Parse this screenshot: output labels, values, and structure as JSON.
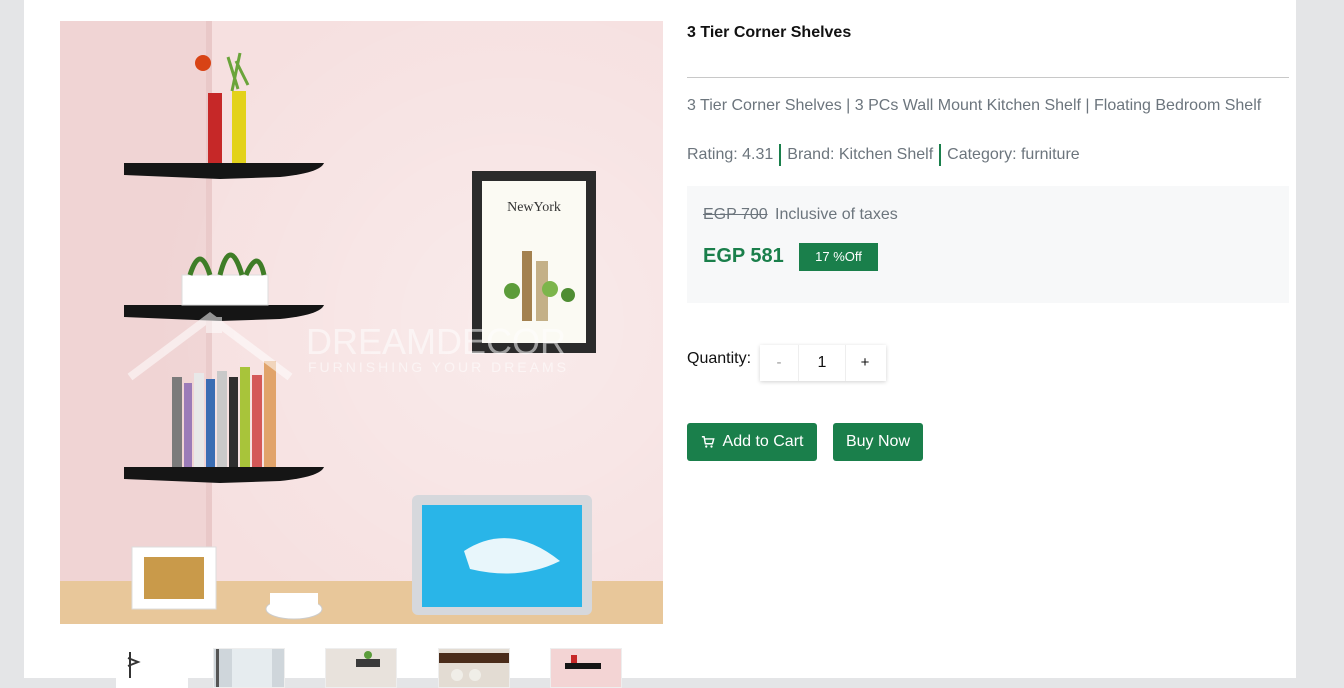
{
  "product": {
    "title": "3 Tier Corner Shelves",
    "description": "3 Tier Corner Shelves | 3 PCs Wall Mount Kitchen Shelf | Floating Bedroom Shelf",
    "rating_text": "Rating: 4.31",
    "brand_text": "Brand: Kitchen Shelf",
    "category_text": "Category: furniture"
  },
  "pricing": {
    "old_price": "EGP 700",
    "tax_note": "Inclusive of taxes",
    "new_price": "EGP 581",
    "discount": "17 %Off"
  },
  "quantity": {
    "label": "Quantity:",
    "minus": "-",
    "value": "1",
    "plus": "+"
  },
  "actions": {
    "add_to_cart": "Add to Cart",
    "buy_now": "Buy Now"
  },
  "gallery": {
    "watermark_brand": "DREAMDECOR",
    "watermark_tagline": "FURNISHING YOUR DREAMS",
    "poster_text": "NewYork",
    "thumbnails": [
      "thumb-1",
      "thumb-2",
      "thumb-3",
      "thumb-4",
      "thumb-5"
    ]
  },
  "colors": {
    "accent": "#1a7f4b",
    "muted_text": "#6c757d",
    "price_box_bg": "#f7f8f9",
    "page_bg": "#e4e5e7"
  },
  "icons": {
    "cart": "shopping-cart-icon"
  }
}
